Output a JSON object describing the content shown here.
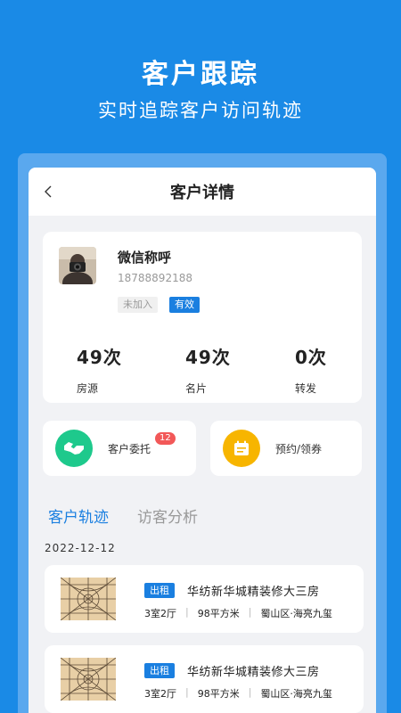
{
  "hero": {
    "title": "客户跟踪",
    "subtitle": "实时追踪客户访问轨迹"
  },
  "navbar": {
    "title": "客户详情",
    "back_icon": "chevron-left-icon"
  },
  "profile": {
    "nickname": "微信称呼",
    "phone": "18788892188",
    "tags": [
      "未加入",
      "有效"
    ],
    "stats": [
      {
        "value": "49次",
        "label": "房源"
      },
      {
        "value": "49次",
        "label": "名片"
      },
      {
        "value": "0次",
        "label": "转发"
      }
    ]
  },
  "actions": {
    "entrust": {
      "label": "客户委托",
      "badge": "12",
      "icon": "handshake-icon",
      "color": "#1ec98c"
    },
    "booking": {
      "label": "预约/领券",
      "icon": "calendar-icon",
      "color": "#f7b500"
    }
  },
  "tabs": {
    "trail": "客户轨迹",
    "analysis": "访客分析"
  },
  "timeline": {
    "date": "2022-12-12",
    "items": [
      {
        "tag": "出租",
        "title": "华纺新华城精装修大三房",
        "layout": "3室2厅",
        "area": "98平方米",
        "location": "蜀山区·海亮九玺"
      },
      {
        "tag": "出租",
        "title": "华纺新华城精装修大三房",
        "layout": "3室2厅",
        "area": "98平方米",
        "location": "蜀山区·海亮九玺"
      }
    ]
  },
  "colors": {
    "primary": "#1a7fe0",
    "hero_bg": "#1a8ae6",
    "badge": "#f25858"
  }
}
